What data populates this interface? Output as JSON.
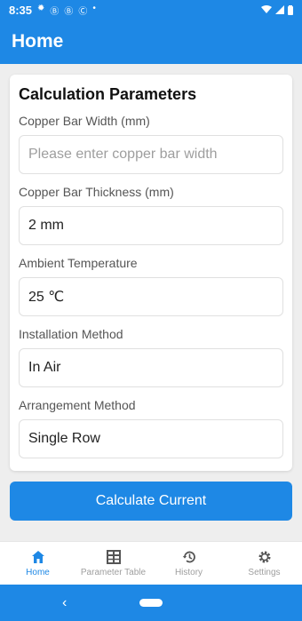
{
  "status_bar": {
    "time": "8:35",
    "icons": [
      "gear-icon",
      "app-icon",
      "app-icon",
      "app-icon",
      "dot"
    ],
    "right_icons": [
      "wifi-icon",
      "signal-icon",
      "battery-icon"
    ]
  },
  "appbar": {
    "title": "Home"
  },
  "form": {
    "title": "Calculation Parameters",
    "fields": [
      {
        "label": "Copper Bar Width (mm)",
        "value": "",
        "placeholder": "Please enter copper bar width"
      },
      {
        "label": "Copper Bar Thickness (mm)",
        "value": "2 mm"
      },
      {
        "label": "Ambient Temperature",
        "value": "25 ℃"
      },
      {
        "label": "Installation Method",
        "value": "In Air"
      },
      {
        "label": "Arrangement Method",
        "value": "Single Row"
      }
    ]
  },
  "calculate_button": {
    "label": "Calculate Current"
  },
  "bottom_nav": {
    "items": [
      {
        "label": "Home",
        "icon": "home-icon",
        "active": true
      },
      {
        "label": "Parameter Table",
        "icon": "table-icon",
        "active": false
      },
      {
        "label": "History",
        "icon": "history-icon",
        "active": false
      },
      {
        "label": "Settings",
        "icon": "gear-icon",
        "active": false
      }
    ]
  },
  "colors": {
    "primary": "#1e88e5",
    "background": "#eeeeee",
    "inactive": "#9e9e9e"
  }
}
